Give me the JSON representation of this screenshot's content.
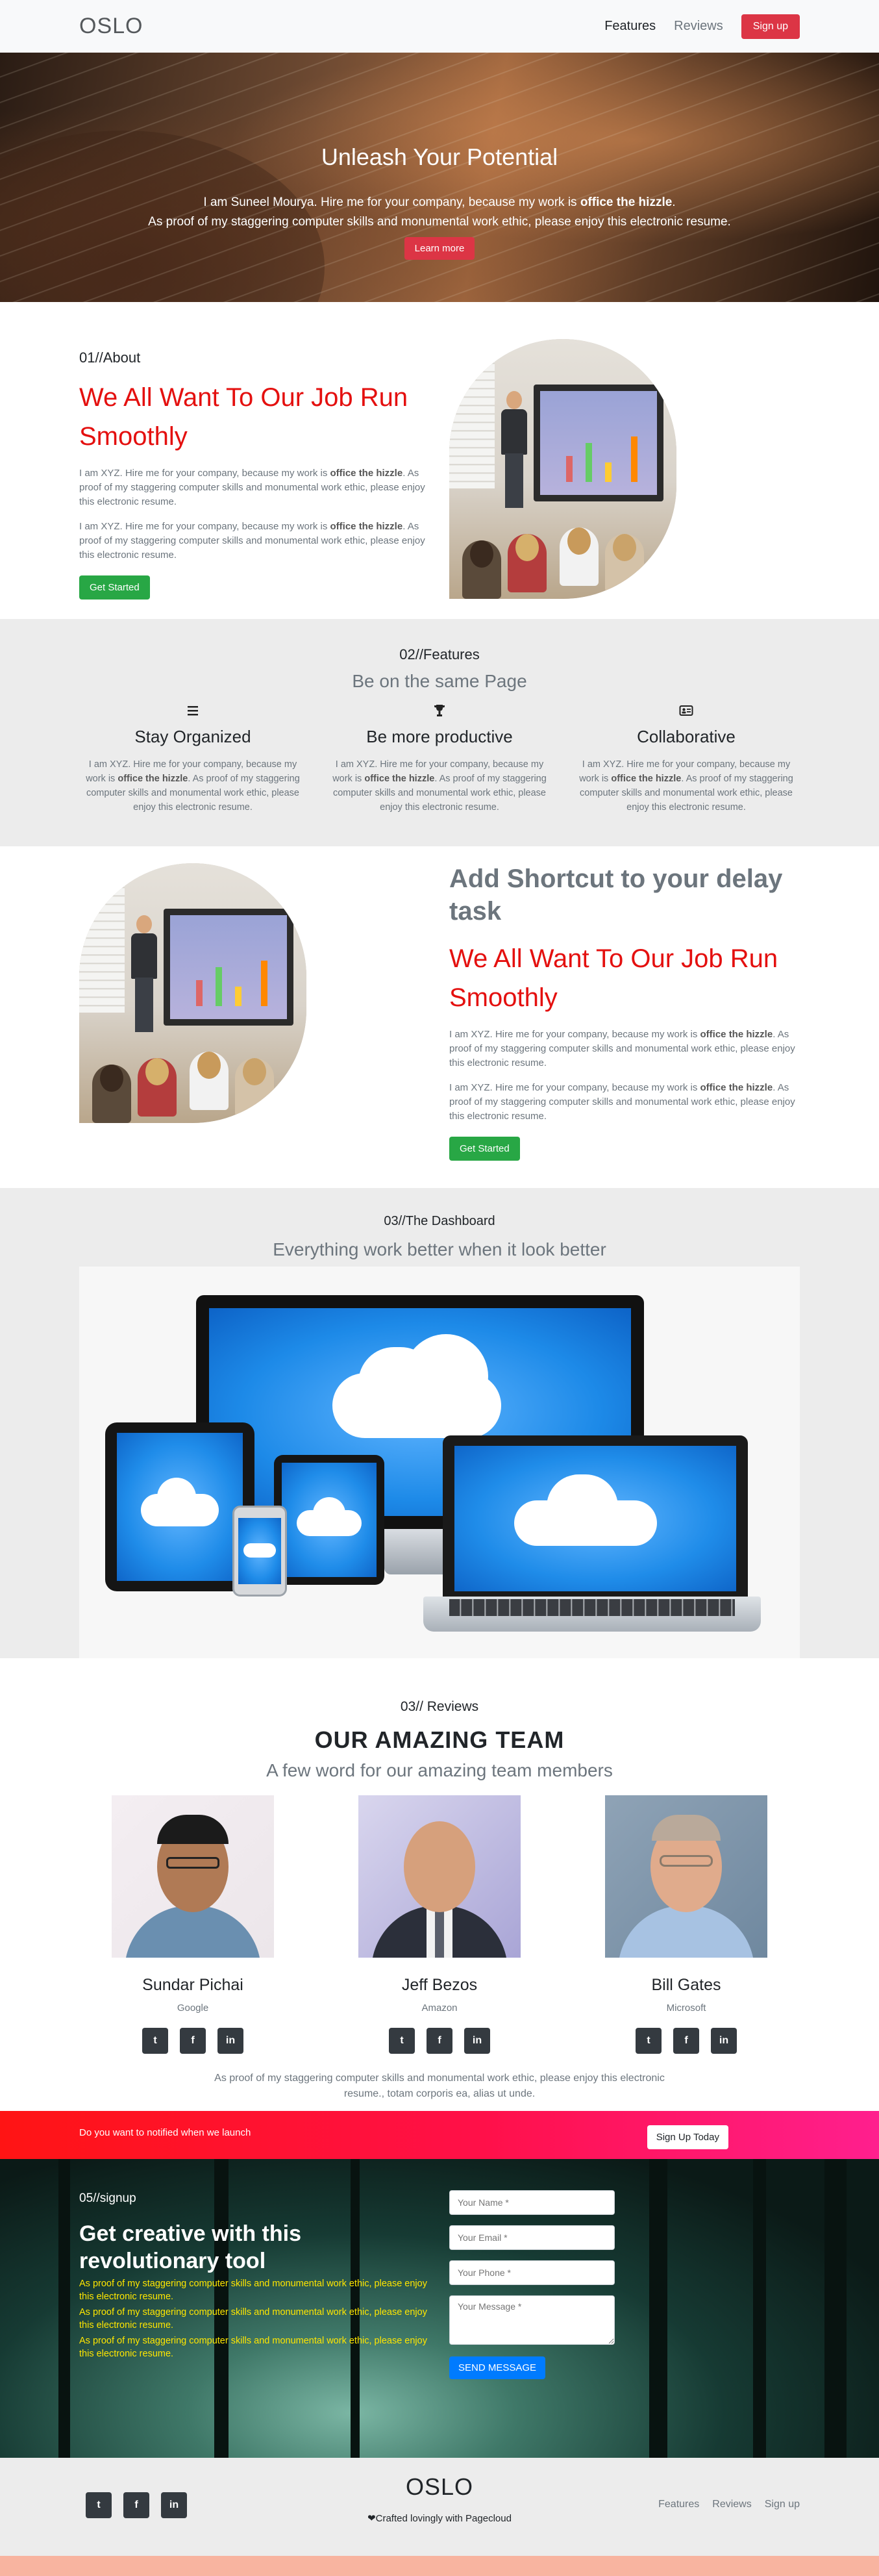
{
  "nav": {
    "brand": "OSLO",
    "links": [
      "Features",
      "Reviews"
    ],
    "signup": "Sign up"
  },
  "hero": {
    "title": "Unleash Your Potential",
    "line1_prefix": "I am Suneel Mourya. Hire me for your company, because my work is ",
    "line1_bold": "office the hizzle",
    "line1_suffix": ".",
    "line2": "As proof of my staggering computer skills and monumental work ethic, please enjoy this electronic resume.",
    "button": "Learn more"
  },
  "about": {
    "kicker": "01//About",
    "headline": "We All Want To Our Job Run Smoothly",
    "para_prefix": "I am XYZ. Hire me for your company, because my work is ",
    "para_bold": "office the hizzle",
    "para_suffix": ". As proof of my staggering computer skills and monumental work ethic, please enjoy this electronic resume.",
    "button": "Get Started"
  },
  "features": {
    "kicker": "02//Features",
    "subtitle": "Be on the same Page",
    "items": [
      {
        "icon": "menu-icon",
        "title": "Stay Organized"
      },
      {
        "icon": "trophy-icon",
        "title": "Be more productive"
      },
      {
        "icon": "id-card-icon",
        "title": "Collaborative"
      }
    ],
    "text_prefix": "I am XYZ. Hire me for your company, because my work is ",
    "text_bold": "office the hizzle",
    "text_suffix": ". As proof of my staggering computer skills and monumental work ethic, please enjoy this electronic resume."
  },
  "shortcut": {
    "title": "Add Shortcut to your delay task",
    "headline": "We All Want To Our Job Run Smoothly",
    "button": "Get Started"
  },
  "dashboard": {
    "kicker": "03//The Dashboard",
    "subtitle": "Everything work better when it look better"
  },
  "reviews": {
    "kicker": "03// Reviews",
    "title": "OUR AMAZING TEAM",
    "subtitle": "A few word for our amazing team members",
    "members": [
      {
        "name": "Sundar Pichai",
        "company": "Google"
      },
      {
        "name": "Jeff Bezos",
        "company": "Amazon"
      },
      {
        "name": "Bill Gates",
        "company": "Microsoft"
      }
    ],
    "social": [
      "twitter-icon",
      "facebook-icon",
      "linkedin-icon"
    ],
    "footer": "As proof of my staggering computer skills and monumental work ethic, please enjoy this electronic resume., totam corporis ea, alias ut unde."
  },
  "notify": {
    "text": "Do you want to notified when we launch",
    "button": "Sign Up Today"
  },
  "signup": {
    "kicker": "05//signup",
    "title": "Get creative with this revolutionary tool",
    "yellow": "As proof of my staggering computer skills and monumental work ethic, please enjoy this electronic resume.",
    "placeholders": {
      "name": "Your Name *",
      "email": "Your Email *",
      "phone": "Your Phone *",
      "message": "Your Message *"
    },
    "button": "SEND MESSAGE"
  },
  "footer": {
    "brand": "OSLO",
    "credit": "Crafted lovingly with Pagecloud",
    "links": [
      "Features",
      "Reviews",
      "Sign up"
    ]
  },
  "colors": {
    "red_headline": "#e4100f",
    "green_button": "#28a745",
    "red_button": "#dc3545",
    "blue_button": "#007bff",
    "yellow_text": "#ffe600"
  }
}
